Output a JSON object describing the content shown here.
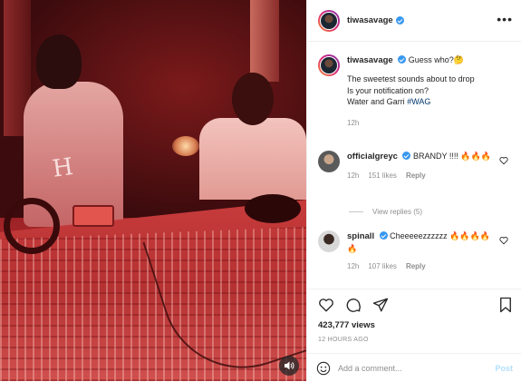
{
  "post": {
    "author": "tiwasavage",
    "verified": true,
    "caption": {
      "first_line": "Guess who?🤔",
      "lines": [
        "The sweetest sounds about to drop",
        "Is your notification on?"
      ],
      "last_line_prefix": "Water and Garri ",
      "hashtag": "#WAG",
      "time": "12h"
    },
    "comments": [
      {
        "username": "officialgreyc",
        "verified": true,
        "text": "BRANDY !!!! 🔥🔥🔥",
        "time": "12h",
        "likes": "151 likes",
        "reply": "Reply",
        "view_replies": "View replies (5)"
      },
      {
        "username": "spinall",
        "verified": true,
        "text": "Cheeeeezzzzzz 🔥🔥🔥🔥🔥",
        "time": "12h",
        "likes": "107 likes",
        "reply": "Reply"
      }
    ],
    "views": "423,777 views",
    "posted_ago": "12 HOURS AGO",
    "add_comment_placeholder": "Add a comment...",
    "post_button": "Post"
  },
  "media": {
    "towel_text": "H",
    "icons": {
      "mute": "speaker-icon"
    }
  },
  "colors": {
    "verified": "#3897f0",
    "muted_text": "#8e8e8e",
    "post_button": "#b2dffc",
    "hashtag": "#00376b"
  }
}
